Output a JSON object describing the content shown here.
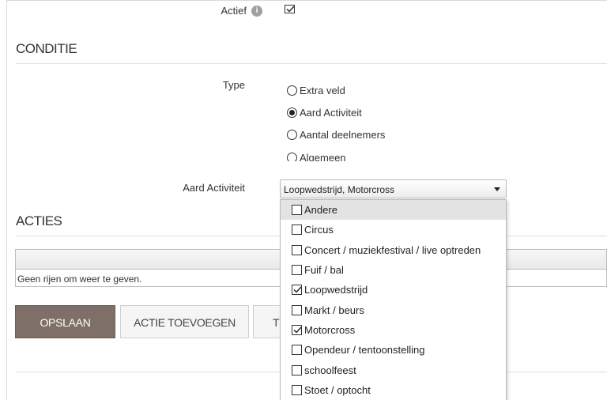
{
  "form": {
    "actief_label": "Actief",
    "actief_checked": true,
    "info_icon_text": "i"
  },
  "conditie": {
    "title": "CONDITIE",
    "type_label": "Type",
    "type_options": [
      {
        "label": "Extra veld",
        "selected": false
      },
      {
        "label": "Aard Activiteit",
        "selected": true
      },
      {
        "label": "Aantal deelnemers",
        "selected": false
      },
      {
        "label": "Algemeen",
        "selected": false
      }
    ],
    "aard_label": "Aard Activiteit",
    "aard_value": "Loopwedstrijd, Motorcross"
  },
  "dropdown": {
    "items": [
      {
        "label": "Andere",
        "checked": false
      },
      {
        "label": "Circus",
        "checked": false
      },
      {
        "label": "Concert / muziekfestival / live optreden",
        "checked": false
      },
      {
        "label": "Fuif / bal",
        "checked": false
      },
      {
        "label": "Loopwedstrijd",
        "checked": true
      },
      {
        "label": "Markt / beurs",
        "checked": false
      },
      {
        "label": "Motorcross",
        "checked": true
      },
      {
        "label": "Opendeur / tentoonstelling",
        "checked": false
      },
      {
        "label": "schoolfeest",
        "checked": false
      },
      {
        "label": "Stoet / optocht",
        "checked": false
      }
    ]
  },
  "acties": {
    "title": "ACTIES",
    "empty_text": "Geen rijen om weer te geven."
  },
  "buttons": {
    "save": "OPSLAAN",
    "add_action": "ACTIE TOEVOEGEN",
    "third": "T"
  },
  "colors": {
    "save_button_bg": "#7e7069",
    "hover_bg": "#e3e3e3"
  }
}
